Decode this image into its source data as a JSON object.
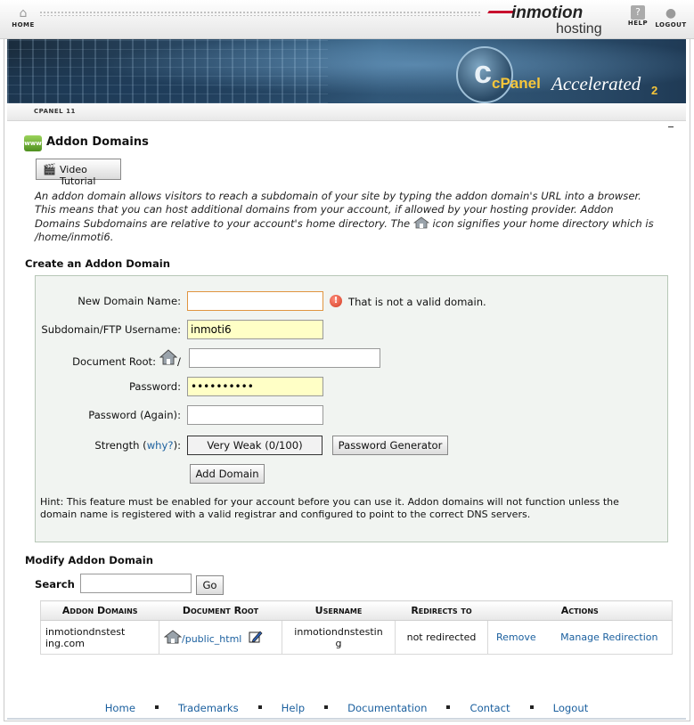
{
  "topbar": {
    "home_label": "HOME",
    "help_label": "HELP",
    "logout_label": "LOGOUT",
    "brand_name": "inmotion",
    "brand_sub": "hosting"
  },
  "banner": {
    "logo_c": "c",
    "logo_panel": "cPanel",
    "logo_accel": "Accelerated",
    "logo_num": "2"
  },
  "cpanel_bar": {
    "label": "CPANEL 11"
  },
  "page": {
    "title": "Addon Domains",
    "video_button": "Video Tutorial",
    "description_part1": "An addon domain allows visitors to reach a subdomain of your site by typing the addon domain's URL into a browser. This means that you can host additional domains from your account, if allowed by your hosting provider. Addon Domains Subdomains are relative to your account's home directory. The ",
    "description_part2": " icon signifies your home directory which is /home/inmoti6."
  },
  "create": {
    "section_title": "Create an Addon Domain",
    "new_domain_label": "New Domain Name:",
    "new_domain_value": "",
    "error_text": "That is not a valid domain.",
    "subdomain_label": "Subdomain/FTP Username:",
    "subdomain_value": "inmoti6",
    "docroot_label": "Document Root:",
    "docroot_slash": "/",
    "docroot_value": "",
    "password_label": "Password:",
    "password_value": "••••••••••",
    "password_again_label": "Password (Again):",
    "password_again_value": "",
    "strength_label": "Strength (",
    "strength_link": "why?",
    "strength_label_end": "):",
    "strength_value": "Very Weak (0/100)",
    "generator_button": "Password Generator",
    "add_button": "Add Domain",
    "hint": "Hint: This feature must be enabled for your account before you can use it. Addon domains will not function unless the domain name is registered with a valid registrar and configured to point to the correct DNS servers."
  },
  "modify": {
    "section_title": "Modify Addon Domain",
    "search_label": "Search",
    "search_value": "",
    "go_button": "Go",
    "columns": [
      "Addon Domains",
      "Document Root",
      "Username",
      "Redirects to",
      "Actions"
    ],
    "rows": [
      {
        "domain": "inmotiondnstesting.com",
        "docroot": "/public_html",
        "username": "inmotiondnstesting",
        "redirect": "not redirected",
        "remove": "Remove",
        "manage": "Manage Redirection"
      }
    ]
  },
  "footer": [
    "Home",
    "Trademarks",
    "Help",
    "Documentation",
    "Contact",
    "Logout"
  ]
}
